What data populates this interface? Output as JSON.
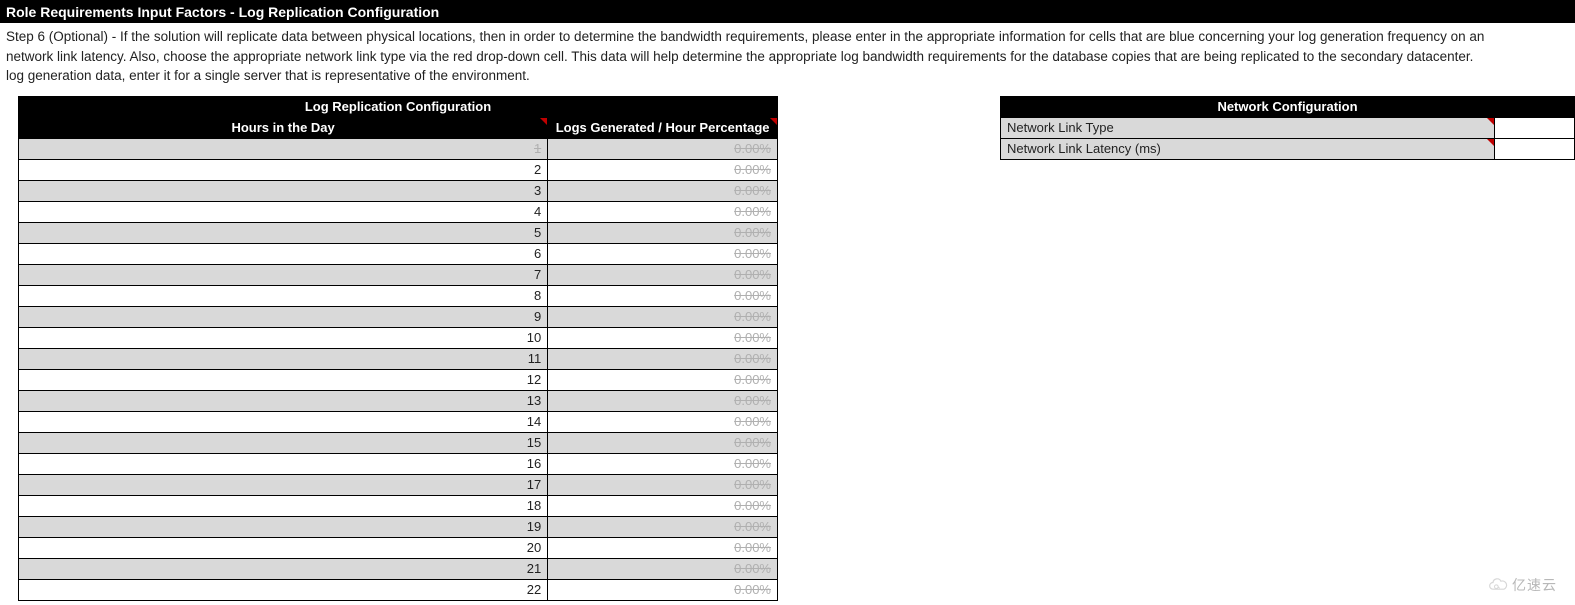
{
  "title": "Role Requirements Input Factors - Log Replication Configuration",
  "instruction_lines": [
    "Step 6 (Optional) - If the solution will replicate data between physical locations, then in order to determine the bandwidth requirements, please enter in the appropriate information for cells that are blue concerning your log generation frequency on an",
    "network link latency.  Also, choose the appropriate network link type via the red drop-down cell.  This data will help determine the appropriate log bandwidth requirements for the database copies that are being replicated to the secondary datacenter.",
    "log generation data, enter it for a single server that is representative of the environment."
  ],
  "log_table": {
    "title": "Log Replication Configuration",
    "col_hours": "Hours in the Day",
    "col_pct": "Logs Generated / Hour Percentage",
    "rows": [
      {
        "hour": "1",
        "pct": "0.00%"
      },
      {
        "hour": "2",
        "pct": "0.00%"
      },
      {
        "hour": "3",
        "pct": "0.00%"
      },
      {
        "hour": "4",
        "pct": "0.00%"
      },
      {
        "hour": "5",
        "pct": "0.00%"
      },
      {
        "hour": "6",
        "pct": "0.00%"
      },
      {
        "hour": "7",
        "pct": "0.00%"
      },
      {
        "hour": "8",
        "pct": "0.00%"
      },
      {
        "hour": "9",
        "pct": "0.00%"
      },
      {
        "hour": "10",
        "pct": "0.00%"
      },
      {
        "hour": "11",
        "pct": "0.00%"
      },
      {
        "hour": "12",
        "pct": "0.00%"
      },
      {
        "hour": "13",
        "pct": "0.00%"
      },
      {
        "hour": "14",
        "pct": "0.00%"
      },
      {
        "hour": "15",
        "pct": "0.00%"
      },
      {
        "hour": "16",
        "pct": "0.00%"
      },
      {
        "hour": "17",
        "pct": "0.00%"
      },
      {
        "hour": "18",
        "pct": "0.00%"
      },
      {
        "hour": "19",
        "pct": "0.00%"
      },
      {
        "hour": "20",
        "pct": "0.00%"
      },
      {
        "hour": "21",
        "pct": "0.00%"
      },
      {
        "hour": "22",
        "pct": "0.00%"
      }
    ]
  },
  "net_table": {
    "title": "Network Configuration",
    "rows": [
      {
        "label": "Network Link Type",
        "value": ""
      },
      {
        "label": "Network Link Latency (ms)",
        "value": ""
      }
    ]
  },
  "watermark": "亿速云"
}
